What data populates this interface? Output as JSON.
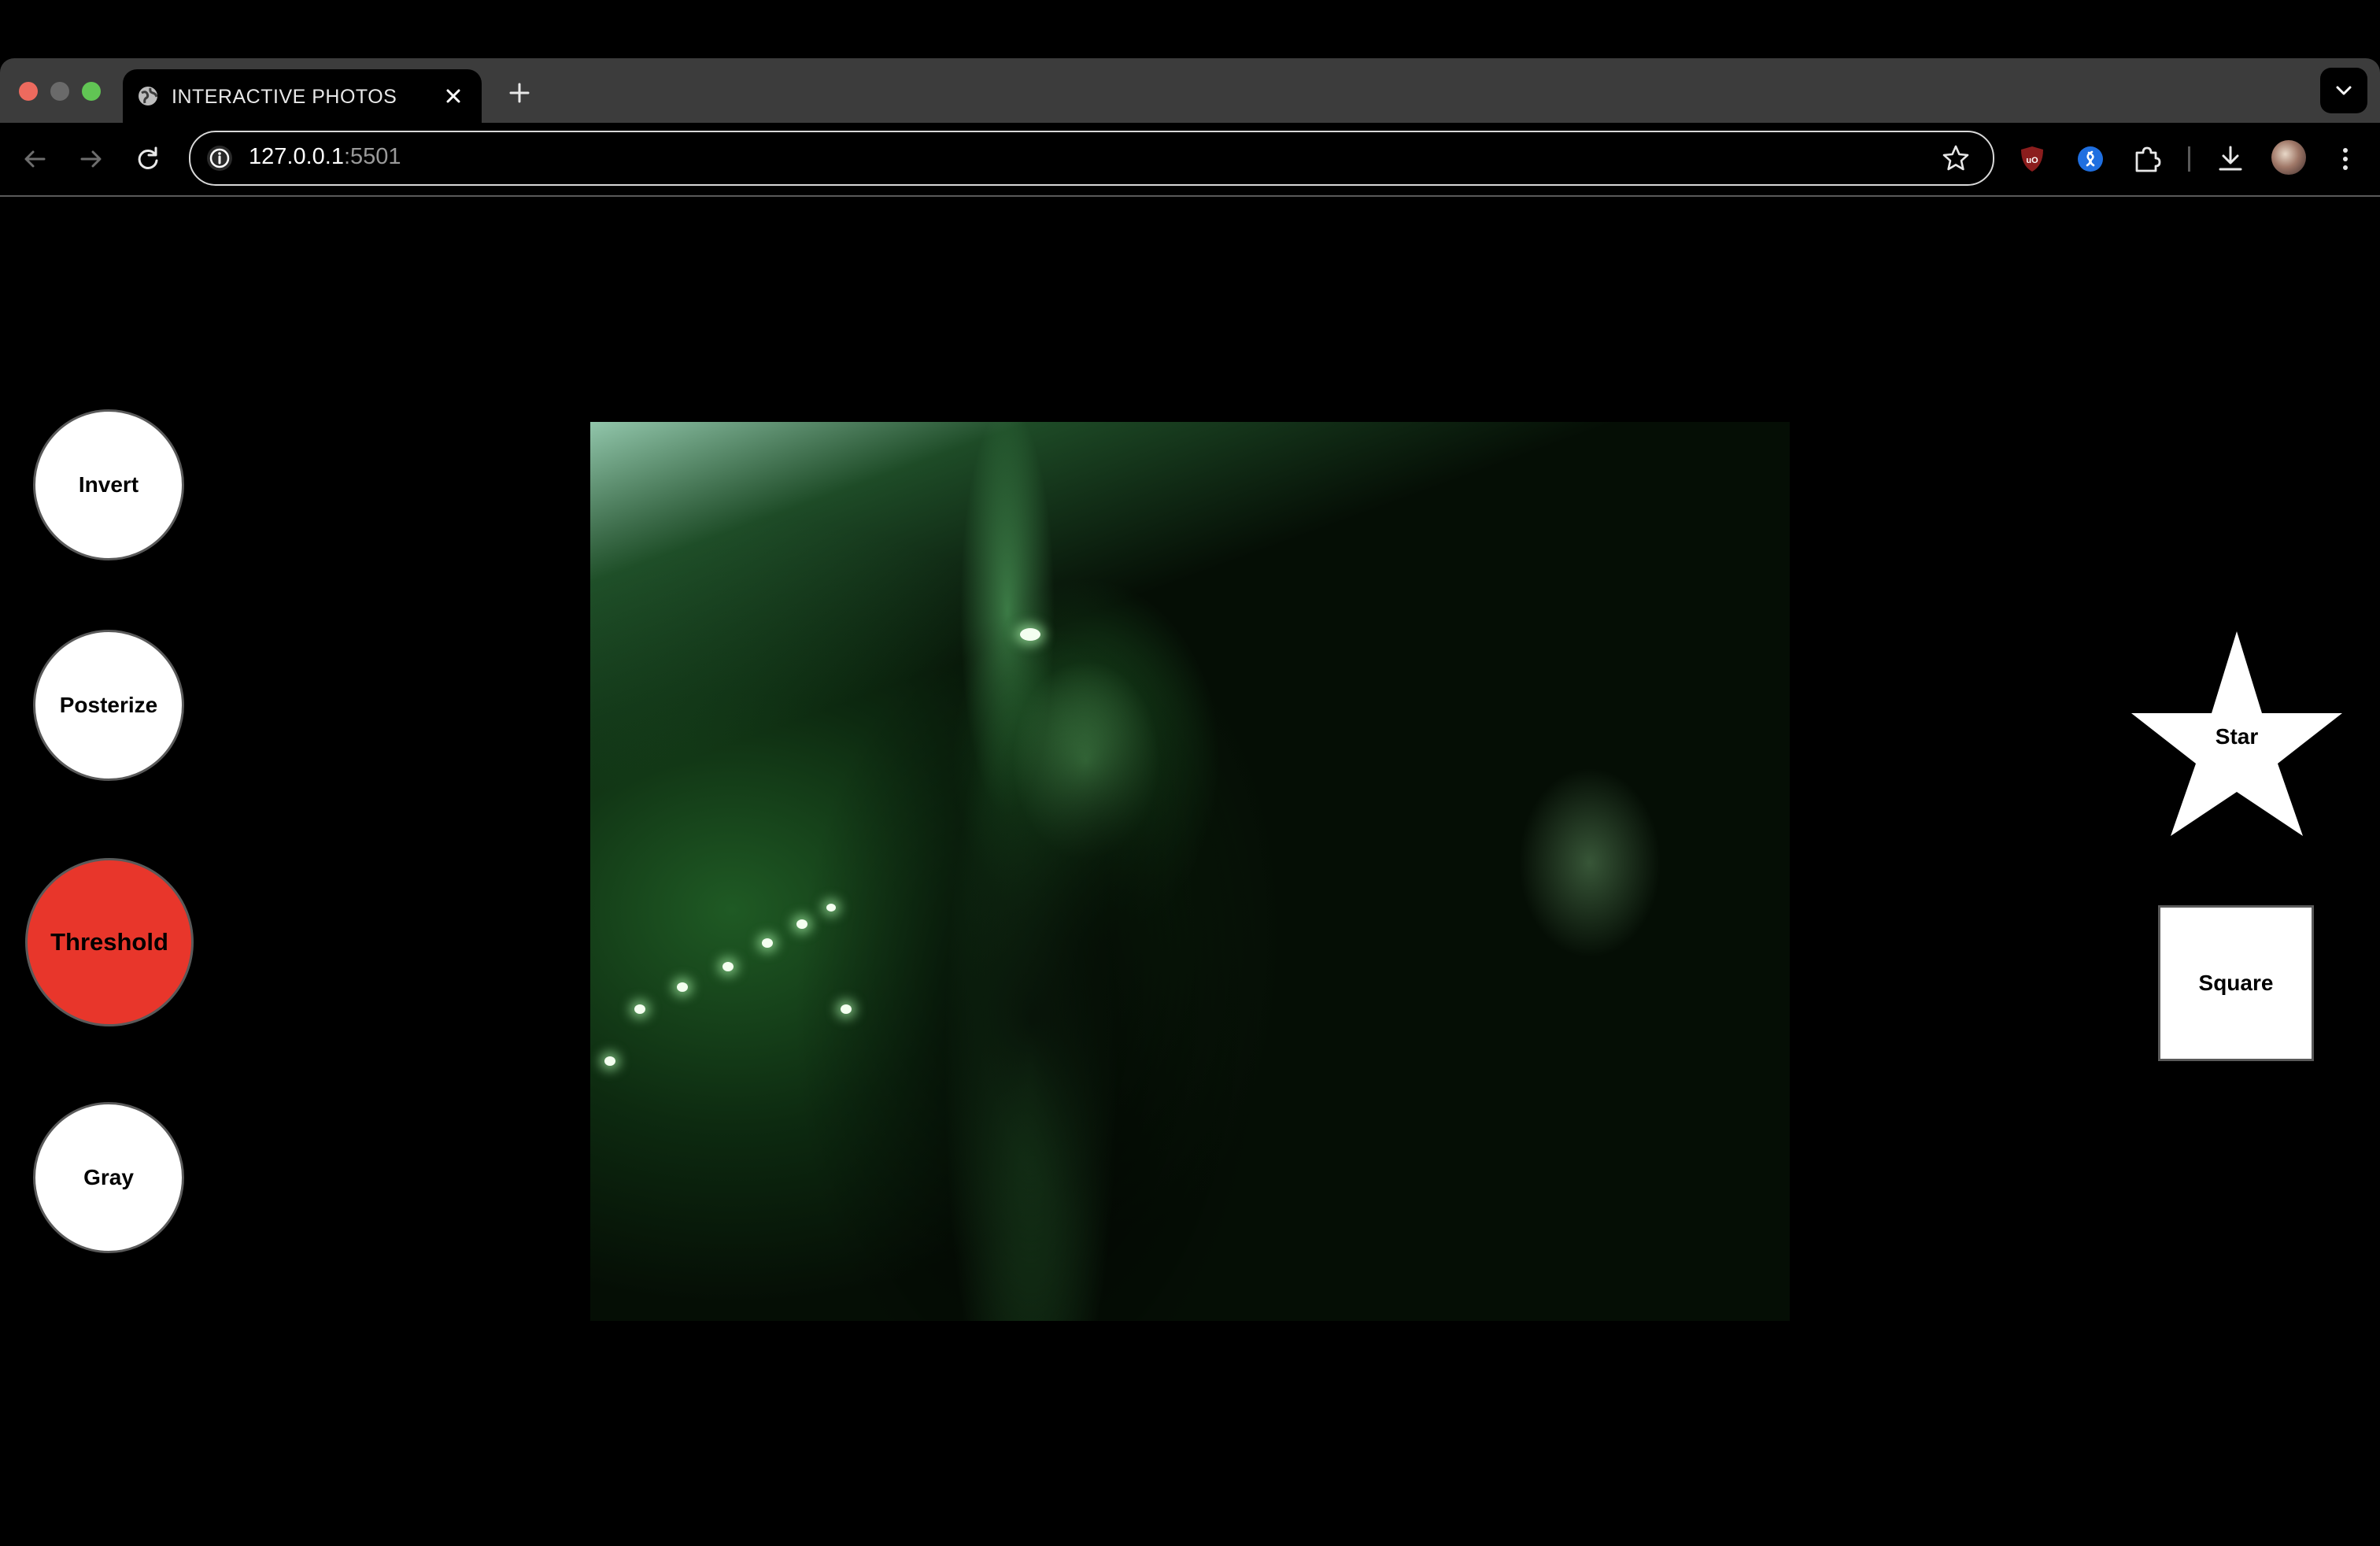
{
  "browser": {
    "tab_title": "INTERACTIVE PHOTOS",
    "url_host": "127.0.0.1",
    "url_port": ":5501"
  },
  "filters": [
    {
      "label": "Invert",
      "active": false
    },
    {
      "label": "Posterize",
      "active": false
    },
    {
      "label": "Threshold",
      "active": true
    },
    {
      "label": "Gray",
      "active": false
    }
  ],
  "shapes": {
    "star_label": "Star",
    "square_label": "Square"
  },
  "colors": {
    "active_filter": "#e8362b",
    "button_fill": "#ffffff",
    "background": "#000000"
  }
}
